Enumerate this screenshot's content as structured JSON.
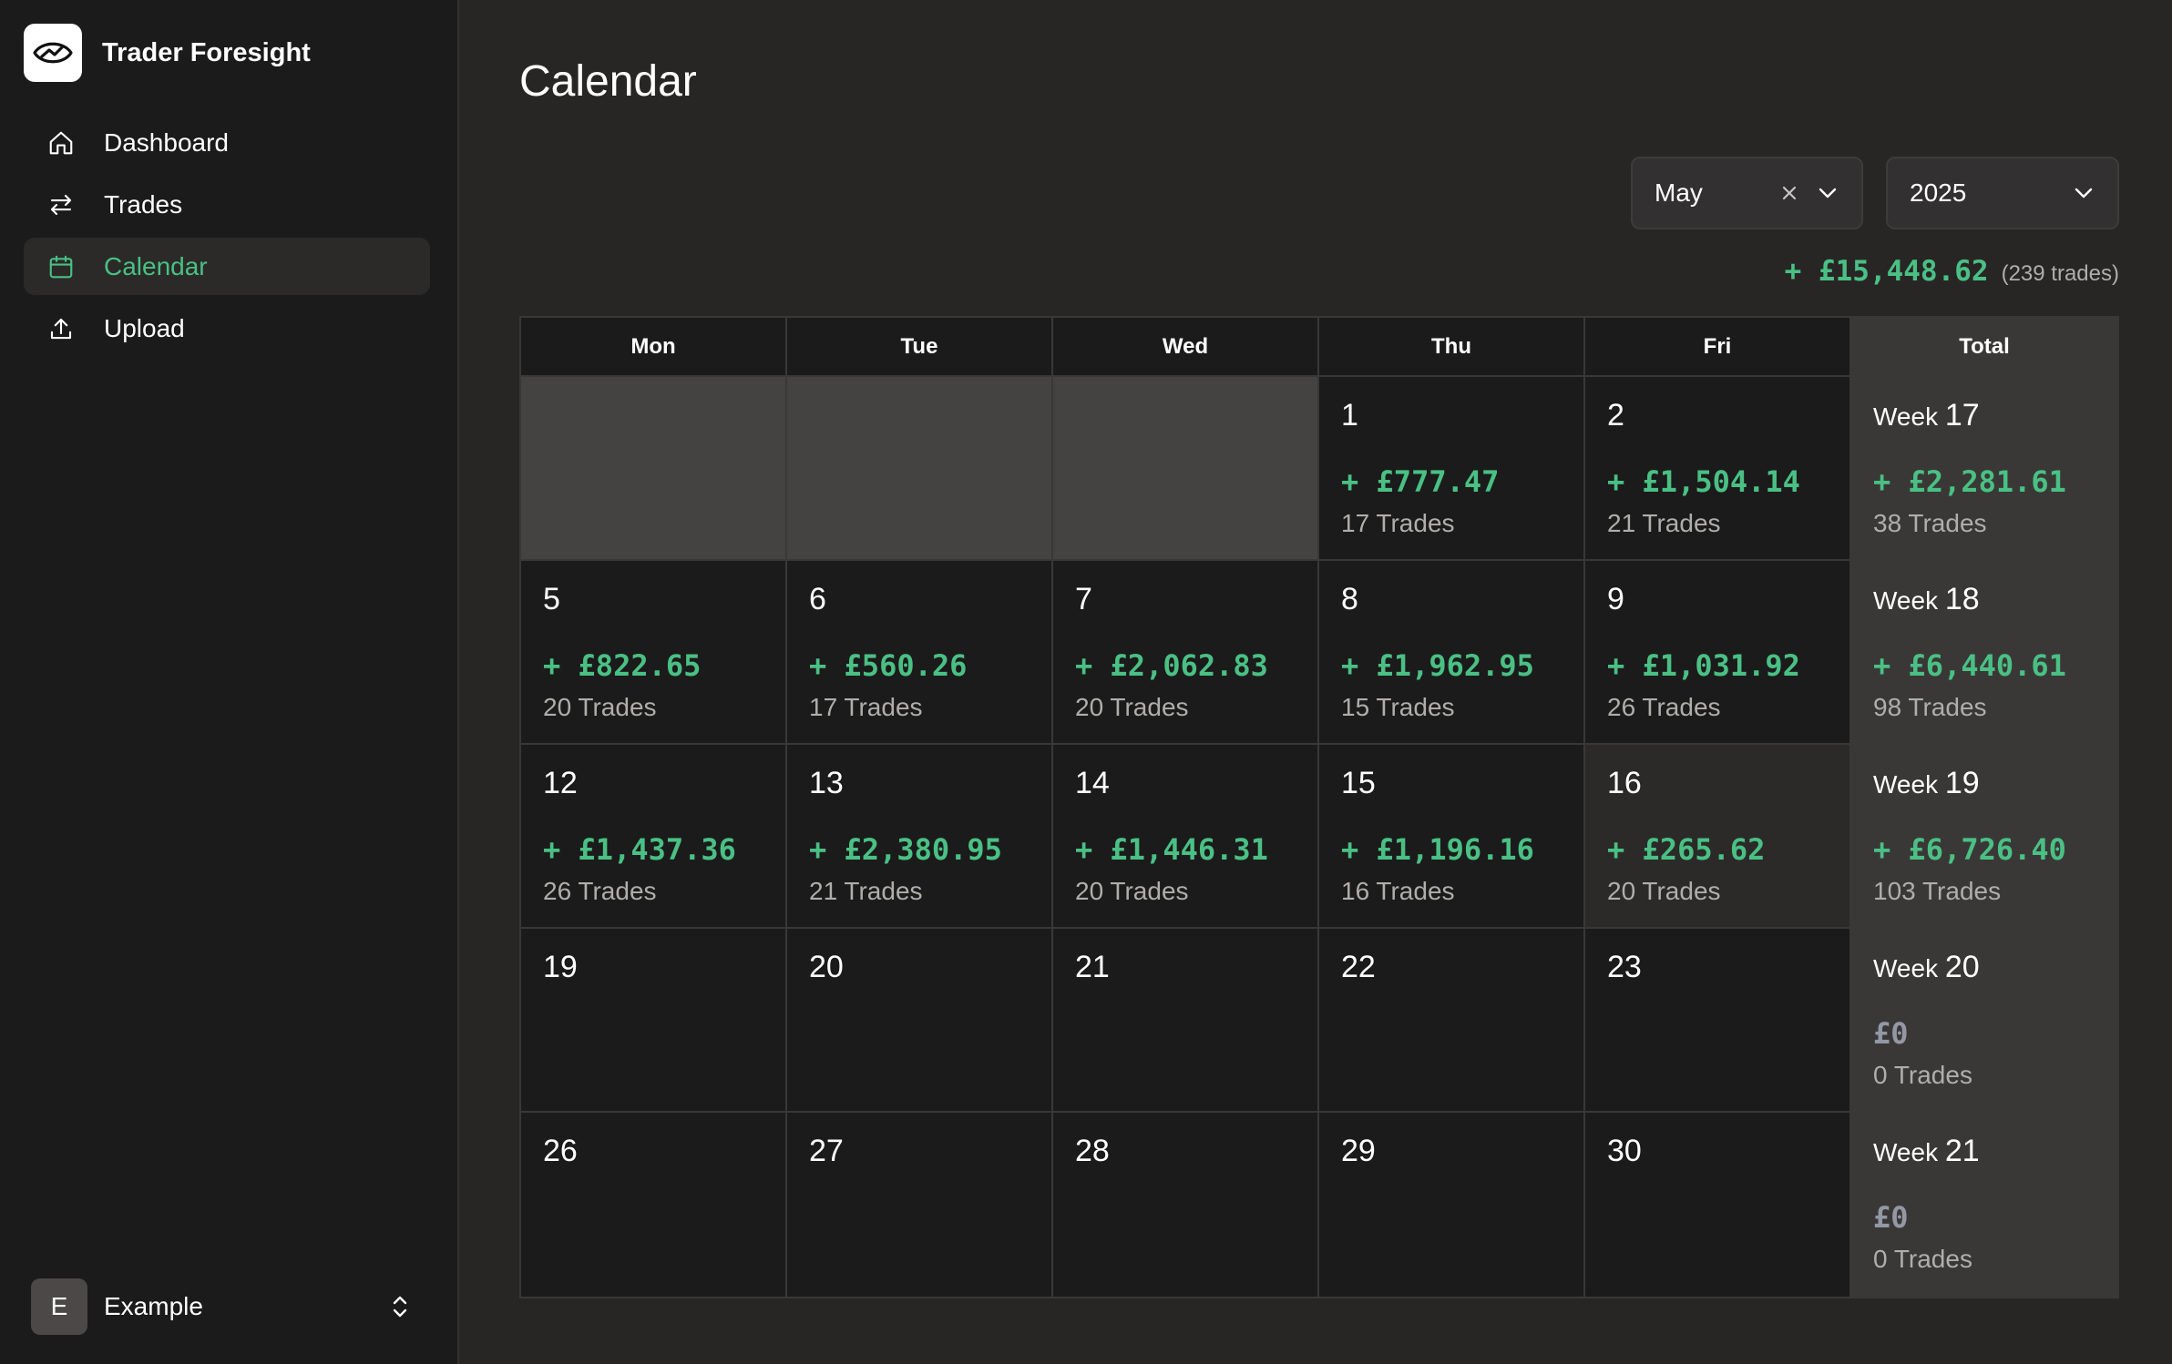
{
  "app": {
    "name": "Trader Foresight",
    "logo_icon": "eye-chart-logo-icon"
  },
  "nav": [
    {
      "label": "Dashboard",
      "icon": "home-icon",
      "active": false
    },
    {
      "label": "Trades",
      "icon": "swap-arrows-icon",
      "active": false
    },
    {
      "label": "Calendar",
      "icon": "calendar-icon",
      "active": true
    },
    {
      "label": "Upload",
      "icon": "upload-icon",
      "active": false
    }
  ],
  "user": {
    "initial": "E",
    "name": "Example"
  },
  "page": {
    "title": "Calendar"
  },
  "filters": {
    "month": "May",
    "year": "2025"
  },
  "summary": {
    "amount": "+ £15,448.62",
    "count": "(239 trades)"
  },
  "calendar": {
    "headers": [
      "Mon",
      "Tue",
      "Wed",
      "Thu",
      "Fri",
      "Total"
    ],
    "week_prefix": "Week",
    "rows": [
      {
        "days": [
          {
            "empty": true
          },
          {
            "empty": true
          },
          {
            "empty": true
          },
          {
            "day": "1",
            "pnl": "+ £777.47",
            "trades": "17 Trades"
          },
          {
            "day": "2",
            "pnl": "+ £1,504.14",
            "trades": "21 Trades"
          }
        ],
        "total": {
          "week": "17",
          "pnl": "+ £2,281.61",
          "trades": "38 Trades"
        }
      },
      {
        "days": [
          {
            "day": "5",
            "pnl": "+ £822.65",
            "trades": "20 Trades"
          },
          {
            "day": "6",
            "pnl": "+ £560.26",
            "trades": "17 Trades"
          },
          {
            "day": "7",
            "pnl": "+ £2,062.83",
            "trades": "20 Trades"
          },
          {
            "day": "8",
            "pnl": "+ £1,962.95",
            "trades": "15 Trades"
          },
          {
            "day": "9",
            "pnl": "+ £1,031.92",
            "trades": "26 Trades"
          }
        ],
        "total": {
          "week": "18",
          "pnl": "+ £6,440.61",
          "trades": "98 Trades"
        }
      },
      {
        "days": [
          {
            "day": "12",
            "pnl": "+ £1,437.36",
            "trades": "26 Trades"
          },
          {
            "day": "13",
            "pnl": "+ £2,380.95",
            "trades": "21 Trades"
          },
          {
            "day": "14",
            "pnl": "+ £1,446.31",
            "trades": "20 Trades"
          },
          {
            "day": "15",
            "pnl": "+ £1,196.16",
            "trades": "16 Trades"
          },
          {
            "day": "16",
            "pnl": "+ £265.62",
            "trades": "20 Trades",
            "highlight": true
          }
        ],
        "total": {
          "week": "19",
          "pnl": "+ £6,726.40",
          "trades": "103 Trades"
        }
      },
      {
        "days": [
          {
            "day": "19"
          },
          {
            "day": "20"
          },
          {
            "day": "21"
          },
          {
            "day": "22"
          },
          {
            "day": "23"
          }
        ],
        "total": {
          "week": "20",
          "pnl": "£0",
          "trades": "0 Trades",
          "zero": true
        }
      },
      {
        "days": [
          {
            "day": "26"
          },
          {
            "day": "27"
          },
          {
            "day": "28"
          },
          {
            "day": "29"
          },
          {
            "day": "30"
          }
        ],
        "total": {
          "week": "21",
          "pnl": "£0",
          "trades": "0 Trades",
          "zero": true
        }
      }
    ]
  },
  "colors": {
    "positive": "#4ac084",
    "zero": "#9298a4",
    "active_nav": "#4ac084"
  }
}
